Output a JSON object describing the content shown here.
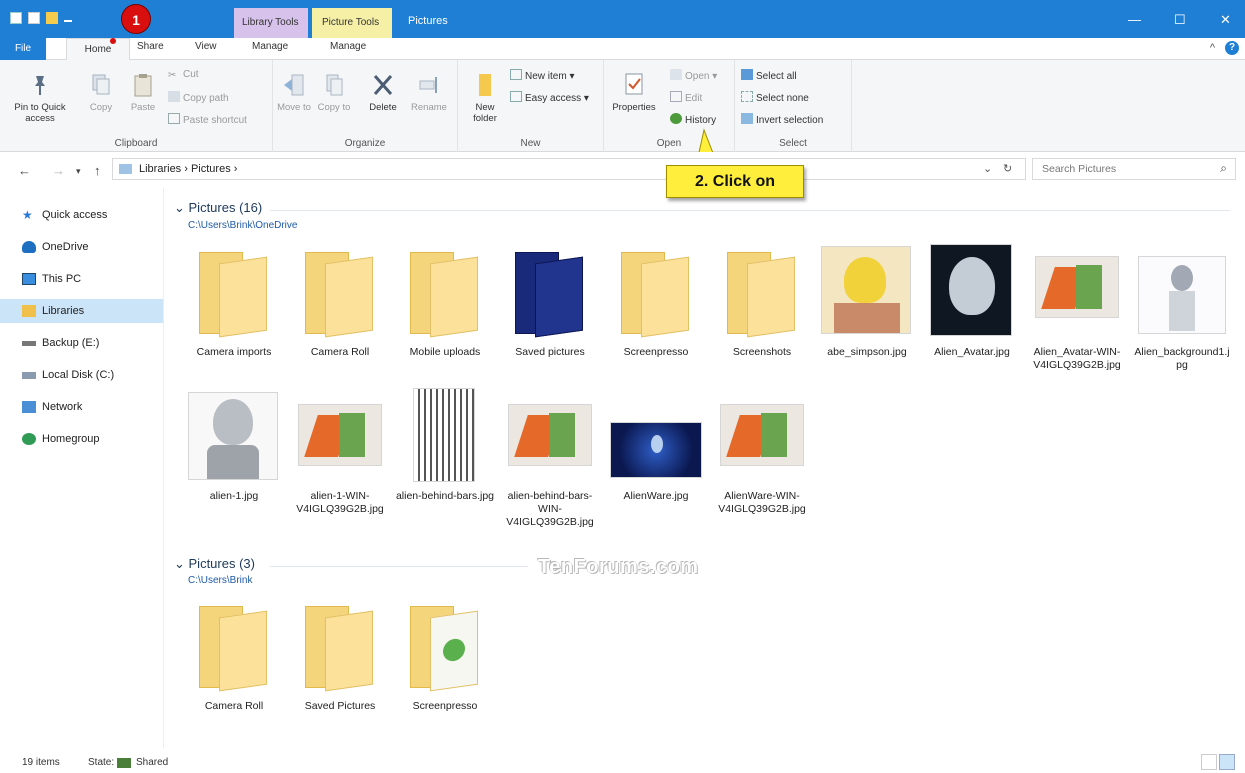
{
  "window": {
    "title": "Pictures",
    "context_tabs": {
      "library": "Library Tools",
      "picture": "Picture Tools"
    },
    "controls": {
      "minimize": "—",
      "maximize": "☐",
      "close": "✕"
    }
  },
  "annotations": {
    "step1": "1",
    "step2": "2. Click on"
  },
  "watermark": "TenForums.com",
  "ribbon": {
    "tabs": {
      "file": "File",
      "home": "Home",
      "share": "Share",
      "view": "View",
      "manage1": "Manage",
      "manage2": "Manage"
    },
    "minimize_glyph": "^",
    "help_glyph": "?",
    "clipboard": {
      "label": "Clipboard",
      "pin": "Pin to Quick access",
      "copy": "Copy",
      "paste": "Paste",
      "cut": "Cut",
      "copy_path": "Copy path",
      "paste_shortcut": "Paste shortcut"
    },
    "organize": {
      "label": "Organize",
      "move_to": "Move to",
      "copy_to": "Copy to",
      "delete": "Delete",
      "rename": "Rename"
    },
    "new": {
      "label": "New",
      "new_folder": "New folder",
      "new_item": "New item",
      "easy_access": "Easy access"
    },
    "open": {
      "label": "Open",
      "properties": "Properties",
      "open": "Open",
      "edit": "Edit",
      "history": "History"
    },
    "select": {
      "label": "Select",
      "select_all": "Select all",
      "select_none": "Select none",
      "invert_selection": "Invert selection"
    }
  },
  "address": {
    "crumbs": "Libraries  ›  Pictures  ›",
    "search_placeholder": "Search Pictures"
  },
  "nav": {
    "items": [
      "Quick access",
      "OneDrive",
      "This PC",
      "Libraries",
      "Backup (E:)",
      "Local Disk (C:)",
      "Network",
      "Homegroup"
    ]
  },
  "groups": [
    {
      "header": "Pictures (16)",
      "path": "C:\\Users\\Brink\\OneDrive",
      "items": [
        "Camera imports",
        "Camera Roll",
        "Mobile uploads",
        "Saved pictures",
        "Screenpresso",
        "Screenshots",
        "abe_simpson.jpg",
        "Alien_Avatar.jpg",
        "Alien_Avatar-WIN-V4IGLQ39G2B.jpg",
        "Alien_background1.jpg",
        "alien-1.jpg",
        "alien-1-WIN-V4IGLQ39G2B.jpg",
        "alien-behind-bars.jpg",
        "alien-behind-bars-WIN-V4IGLQ39G2B.jpg",
        "AlienWare.jpg",
        "AlienWare-WIN-V4IGLQ39G2B.jpg"
      ]
    },
    {
      "header": "Pictures (3)",
      "path": "C:\\Users\\Brink",
      "items": [
        "Camera Roll",
        "Saved Pictures",
        "Screenpresso"
      ]
    }
  ],
  "status": {
    "count": "19 items",
    "state_label": "State:",
    "state_value": "Shared"
  },
  "colors": {
    "accent": "#1f7fd4",
    "callout": "#ffee3b",
    "selection": "#cce4f7"
  }
}
